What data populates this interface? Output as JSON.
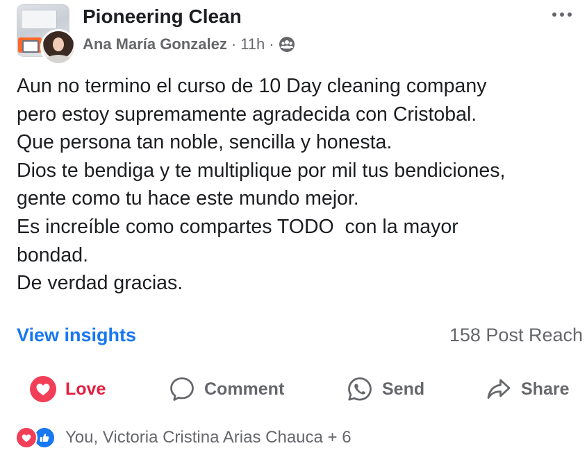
{
  "post": {
    "group_name": "Pioneering Clean",
    "author": "Ana María Gonzalez",
    "separator": "·",
    "time": "11h",
    "separator2": "·",
    "privacy_icon": "group-privacy-icon",
    "more_icon": "more-options-icon",
    "text_lines": [
      "Aun no termino el curso de 10 Day cleaning company",
      "pero estoy supremamente agradecida con Cristobal.",
      "Que persona tan noble, sencilla y honesta.",
      "Dios te bendiga y te multiplique por mil tus bendiciones,",
      "gente como tu hace este mundo mejor.",
      "Es increíble como compartes TODO  con la mayor",
      "bondad.",
      "De verdad gracias."
    ]
  },
  "insights": {
    "link_label": "View insights",
    "reach": "158 Post Reach"
  },
  "actions": {
    "love": "Love",
    "comment": "Comment",
    "send": "Send",
    "share": "Share"
  },
  "reactions": {
    "summary": "You, Victoria Cristina Arias Chauca + 6"
  },
  "colors": {
    "link": "#1877f2",
    "love": "#e41e3f",
    "secondary_text": "#65676b",
    "primary_text": "#1c1e21"
  }
}
